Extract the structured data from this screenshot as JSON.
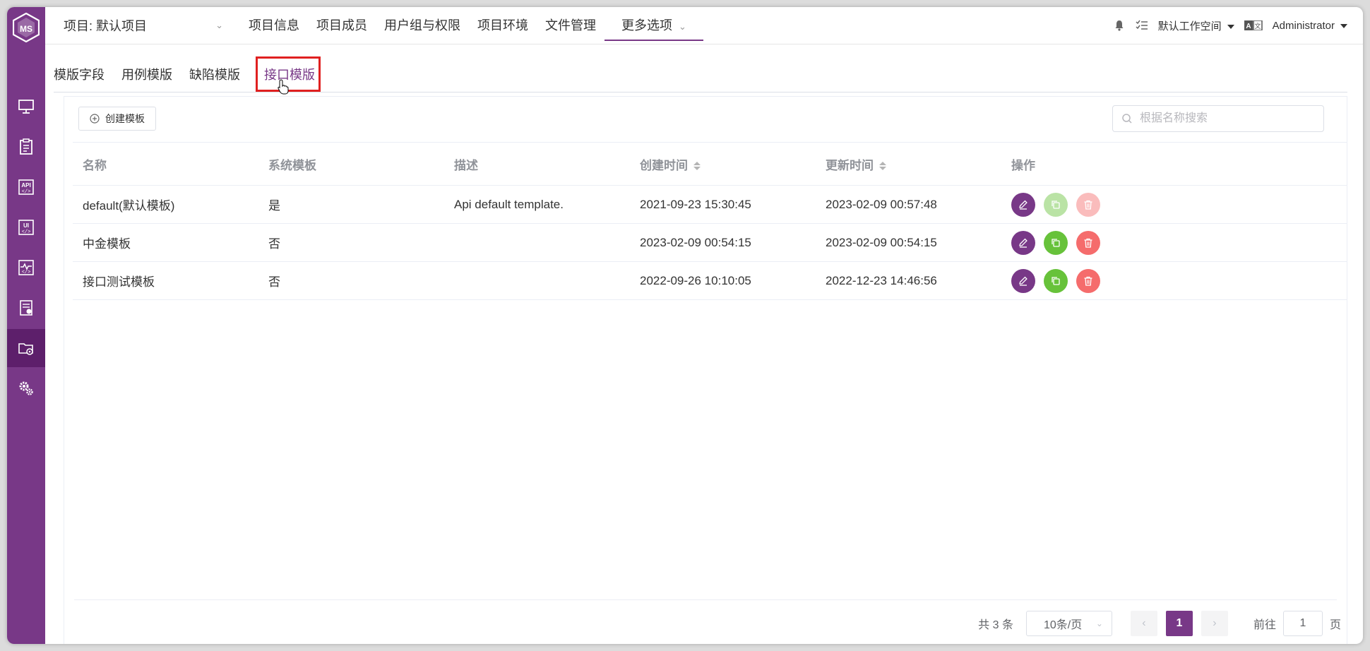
{
  "colors": {
    "brand": "#783887",
    "success": "#67c23a",
    "danger": "#f56c6c",
    "highlight": "#e02020"
  },
  "topbar": {
    "project": "项目: 默认项目",
    "nav": [
      "项目信息",
      "项目成员",
      "用户组与权限",
      "项目环境",
      "文件管理"
    ],
    "more": "更多选项",
    "workspace": "默认工作空间",
    "user": "Administrator"
  },
  "sidebar": {
    "items": [
      "monitor-icon",
      "clipboard-icon",
      "api-icon",
      "ui-icon",
      "performance-icon",
      "report-icon",
      "project-settings-icon",
      "settings-gears-icon"
    ],
    "active": "project-settings-icon"
  },
  "subtabs": [
    "模版字段",
    "用例模版",
    "缺陷模版",
    "接口模版"
  ],
  "active_subtab": "接口模版",
  "toolbar": {
    "create_label": "创建模板",
    "search_placeholder": "根据名称搜索"
  },
  "table": {
    "headers": [
      "名称",
      "系统模板",
      "描述",
      "创建时间",
      "更新时间",
      "操作"
    ],
    "rows": [
      {
        "name": "default(默认模板)",
        "system": "是",
        "desc": "Api default template.",
        "created": "2021-09-23 15:30:45",
        "updated": "2023-02-09 00:57:48",
        "actions_enabled": false
      },
      {
        "name": "中金模板",
        "system": "否",
        "desc": "",
        "created": "2023-02-09 00:54:15",
        "updated": "2023-02-09 00:54:15",
        "actions_enabled": true
      },
      {
        "name": "接口测试模板",
        "system": "否",
        "desc": "",
        "created": "2022-09-26 10:10:05",
        "updated": "2022-12-23 14:46:56",
        "actions_enabled": true
      }
    ]
  },
  "pagination": {
    "total": "共 3 条",
    "page_size": "10条/页",
    "current": "1",
    "goto_label": "前往",
    "goto_value": "1",
    "page_suffix": "页"
  }
}
